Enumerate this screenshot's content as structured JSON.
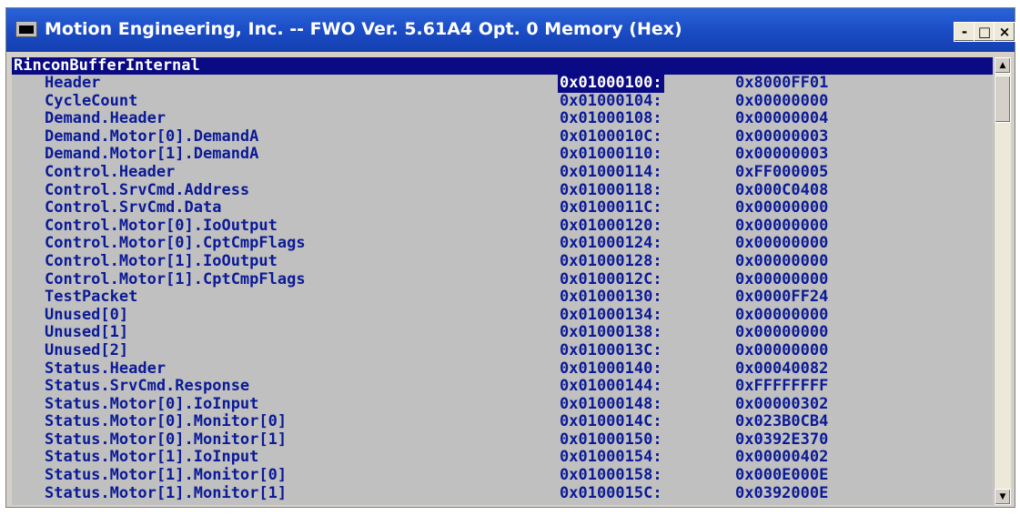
{
  "window": {
    "title": "Motion Engineering, Inc. -- FWO Ver. 5.61A4 Opt. 0 Memory (Hex)",
    "buttons": {
      "minimize": "-",
      "maximize": "□",
      "close": "×"
    }
  },
  "section_header": "RinconBufferInternal",
  "rows": [
    {
      "name": "Header",
      "address": "0x01000100:",
      "value": "0x8000FF01"
    },
    {
      "name": "CycleCount",
      "address": "0x01000104:",
      "value": "0x00000000"
    },
    {
      "name": "Demand.Header",
      "address": "0x01000108:",
      "value": "0x00000004"
    },
    {
      "name": "Demand.Motor[0].DemandA",
      "address": "0x0100010C:",
      "value": "0x00000003"
    },
    {
      "name": "Demand.Motor[1].DemandA",
      "address": "0x01000110:",
      "value": "0x00000003"
    },
    {
      "name": "Control.Header",
      "address": "0x01000114:",
      "value": "0xFF000005"
    },
    {
      "name": "Control.SrvCmd.Address",
      "address": "0x01000118:",
      "value": "0x000C0408"
    },
    {
      "name": "Control.SrvCmd.Data",
      "address": "0x0100011C:",
      "value": "0x00000000"
    },
    {
      "name": "Control.Motor[0].IoOutput",
      "address": "0x01000120:",
      "value": "0x00000000"
    },
    {
      "name": "Control.Motor[0].CptCmpFlags",
      "address": "0x01000124:",
      "value": "0x00000000"
    },
    {
      "name": "Control.Motor[1].IoOutput",
      "address": "0x01000128:",
      "value": "0x00000000"
    },
    {
      "name": "Control.Motor[1].CptCmpFlags",
      "address": "0x0100012C:",
      "value": "0x00000000"
    },
    {
      "name": "TestPacket",
      "address": "0x01000130:",
      "value": "0x0000FF24"
    },
    {
      "name": "Unused[0]",
      "address": "0x01000134:",
      "value": "0x00000000"
    },
    {
      "name": "Unused[1]",
      "address": "0x01000138:",
      "value": "0x00000000"
    },
    {
      "name": "Unused[2]",
      "address": "0x0100013C:",
      "value": "0x00000000"
    },
    {
      "name": "Status.Header",
      "address": "0x01000140:",
      "value": "0x00040082"
    },
    {
      "name": "Status.SrvCmd.Response",
      "address": "0x01000144:",
      "value": "0xFFFFFFFF"
    },
    {
      "name": "Status.Motor[0].IoInput",
      "address": "0x01000148:",
      "value": "0x00000302"
    },
    {
      "name": "Status.Motor[0].Monitor[0]",
      "address": "0x0100014C:",
      "value": "0x023B0CB4"
    },
    {
      "name": "Status.Motor[0].Monitor[1]",
      "address": "0x01000150:",
      "value": "0x0392E370"
    },
    {
      "name": "Status.Motor[1].IoInput",
      "address": "0x01000154:",
      "value": "0x00000402"
    },
    {
      "name": "Status.Motor[1].Monitor[0]",
      "address": "0x01000158:",
      "value": "0x000E000E"
    },
    {
      "name": "Status.Motor[1].Monitor[1]",
      "address": "0x0100015C:",
      "value": "0x0392000E"
    }
  ],
  "scrollbar": {
    "up_arrow": "▲",
    "down_arrow": "▼"
  },
  "colors": {
    "title_bar": "#1a4bc4",
    "background": "#c0c0c0",
    "text": "#0b1a96",
    "highlight": "#0a0a84"
  }
}
